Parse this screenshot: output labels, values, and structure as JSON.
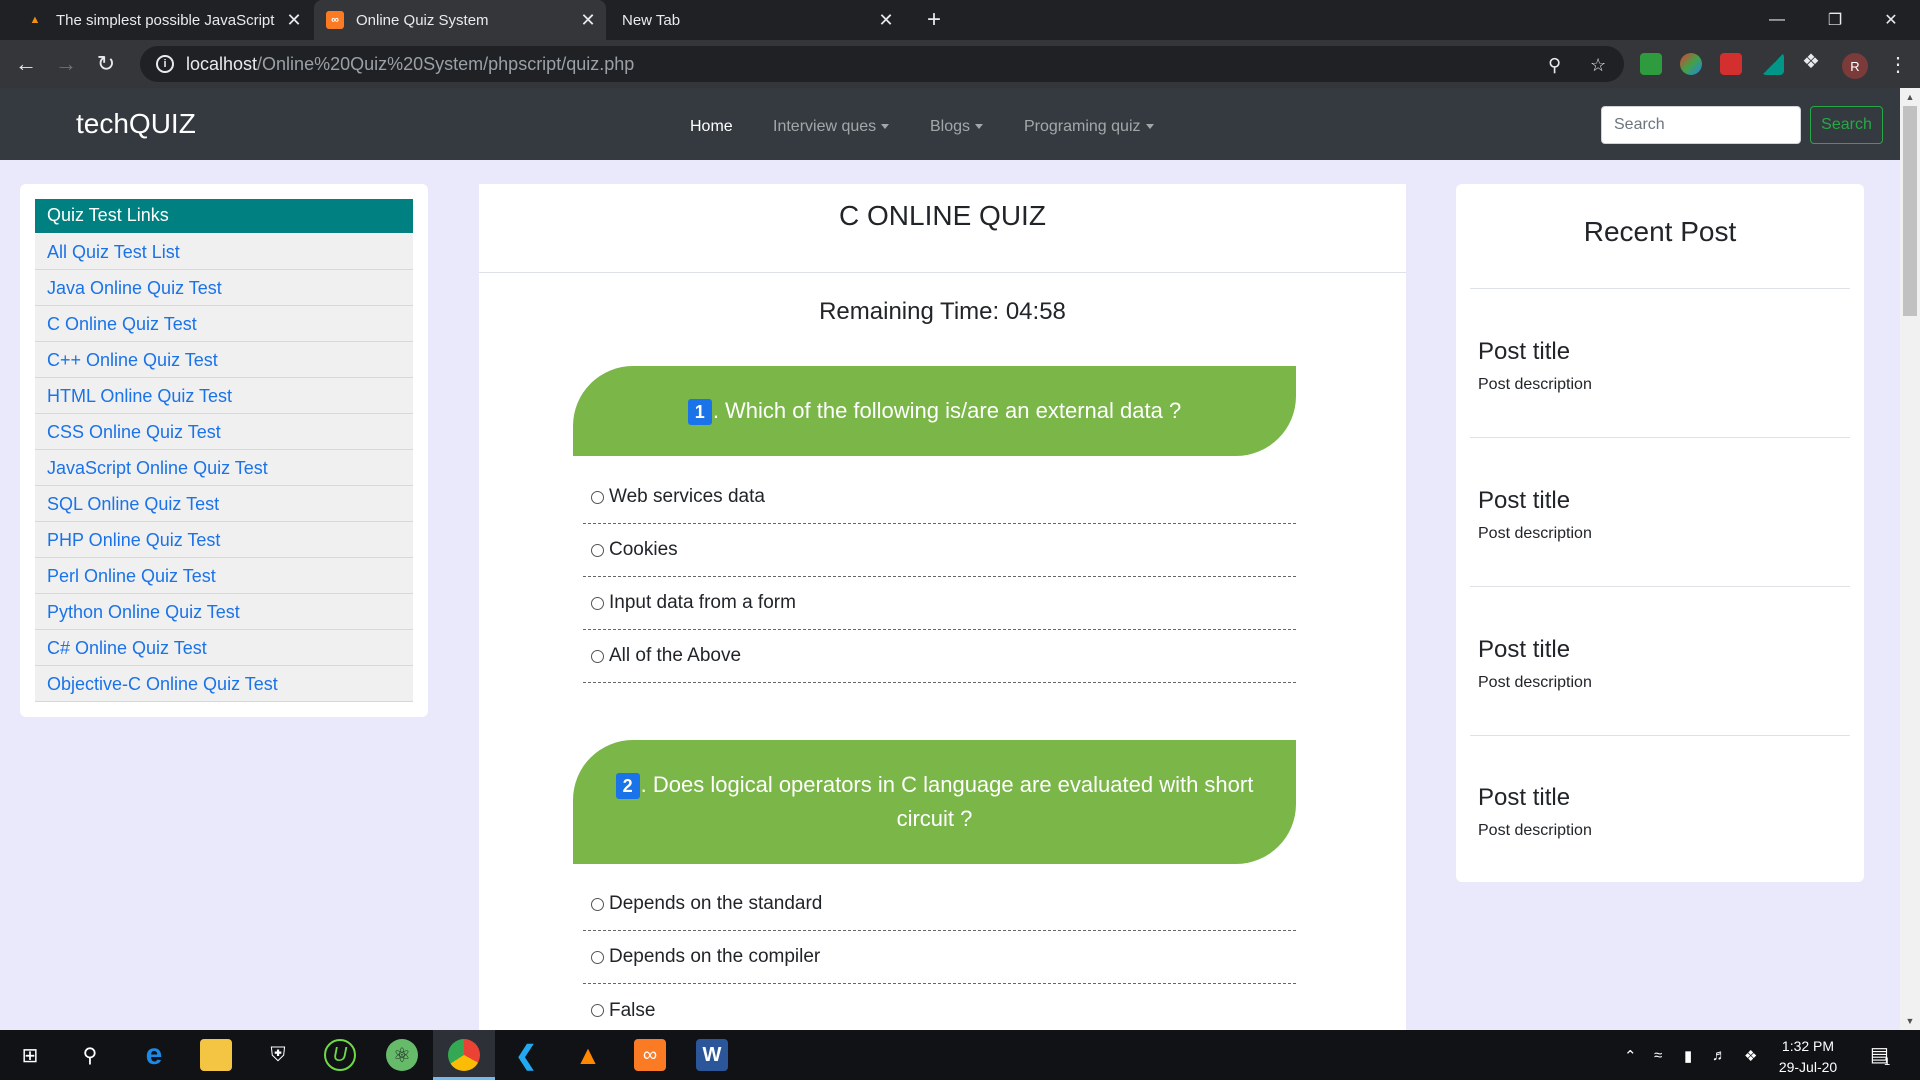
{
  "browser": {
    "tabs": [
      {
        "title": "The simplest possible JavaScript",
        "favicon": "html5-icon"
      },
      {
        "title": "Online Quiz System",
        "favicon": "xampp-icon"
      },
      {
        "title": "New Tab",
        "favicon": ""
      }
    ],
    "active_tab": 1,
    "url_host": "localhost",
    "url_path": "/Online%20Quiz%20System/phpscript/quiz.php",
    "profile_initial": "R"
  },
  "site": {
    "brand": "techQUIZ",
    "nav": [
      "Home",
      "Interview ques",
      "Blogs",
      "Programing quiz"
    ],
    "search_placeholder": "Search",
    "search_button": "Search"
  },
  "sidebar": {
    "header": "Quiz Test Links",
    "items": [
      "All Quiz Test List",
      "Java Online Quiz Test",
      "C Online Quiz Test",
      "C++ Online Quiz Test",
      "HTML Online Quiz Test",
      "CSS Online Quiz Test",
      "JavaScript Online Quiz Test",
      "SQL Online Quiz Test",
      "PHP Online Quiz Test",
      "Perl Online Quiz Test",
      "Python Online Quiz Test",
      "C# Online Quiz Test",
      "Objective-C Online Quiz Test"
    ]
  },
  "quiz": {
    "title": "C ONLINE QUIZ",
    "remaining_time": "Remaining Time: 04:58",
    "questions": [
      {
        "number": "1",
        "text": ". Which of the following is/are an external data ?",
        "options": [
          "Web services data",
          "Cookies",
          "Input data from a form",
          "All of the Above"
        ]
      },
      {
        "number": "2",
        "text": ". Does logical operators in C language are evaluated with short circuit ?",
        "options": [
          "Depends on the standard",
          "Depends on the compiler",
          "False"
        ]
      }
    ]
  },
  "recent": {
    "title": "Recent Post",
    "posts": [
      {
        "title": "Post title",
        "description": "Post description"
      },
      {
        "title": "Post title",
        "description": "Post description"
      },
      {
        "title": "Post title",
        "description": "Post description"
      },
      {
        "title": "Post title",
        "description": "Post description"
      }
    ]
  },
  "taskbar": {
    "time": "1:32 PM",
    "date": "29-Jul-20",
    "notification_count": "1",
    "apps": [
      "windows-start-icon",
      "search-icon",
      "edge-icon",
      "file-explorer-icon",
      "security-icon",
      "upwork-icon",
      "atom-icon",
      "chrome-icon",
      "vscode-icon",
      "vlc-icon",
      "xampp-icon",
      "word-icon"
    ]
  },
  "colors": {
    "page_bg": "#e9e9fb",
    "navbar": "#343a40",
    "sidebar_header": "#008080",
    "link": "#1a73e8",
    "question_bg": "#7ab648",
    "search_button": "#28a745"
  }
}
